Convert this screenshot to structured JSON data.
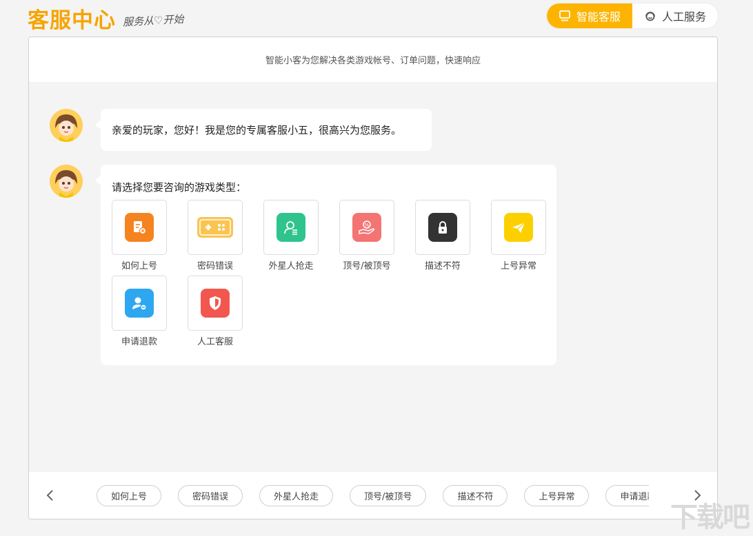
{
  "header": {
    "logo_text": "客服中心",
    "logo_slogan": "服务从♡开始",
    "modes": [
      {
        "label": "智能客服",
        "icon": "monitor-icon",
        "active": true
      },
      {
        "label": "人工服务",
        "icon": "headset-icon",
        "active": false
      }
    ]
  },
  "panel": {
    "subtitle": "智能小客为您解决各类游戏帐号、订单问题，快速响应"
  },
  "messages": {
    "greeting": "亲爱的玩家，您好！我是您的专属客服小五，很高兴为您服务。",
    "prompt": "请选择您要咨询的游戏类型："
  },
  "categories": [
    {
      "label": "如何上号",
      "icon": "document-icon",
      "color": "#f5831f"
    },
    {
      "label": "密码错误",
      "icon": "gamepad-icon",
      "color": "#fbc451"
    },
    {
      "label": "外星人抢走",
      "icon": "user-list-icon",
      "color": "#2fc48d"
    },
    {
      "label": "顶号/被顶号",
      "icon": "hand-percent-icon",
      "color": "#f47474"
    },
    {
      "label": "描述不符",
      "icon": "lock-icon",
      "color": "#333333"
    },
    {
      "label": "上号异常",
      "icon": "paper-plane-icon",
      "color": "#fcd000"
    },
    {
      "label": "申请退款",
      "icon": "user-minus-icon",
      "color": "#2ea7f0"
    },
    {
      "label": "人工客服",
      "icon": "shield-icon",
      "color": "#f2574f"
    }
  ],
  "quickbar": {
    "chips": [
      "如何上号",
      "密码错误",
      "外星人抢走",
      "顶号/被顶号",
      "描述不符",
      "上号异常",
      "申请退款"
    ]
  },
  "watermark": "下载吧"
}
